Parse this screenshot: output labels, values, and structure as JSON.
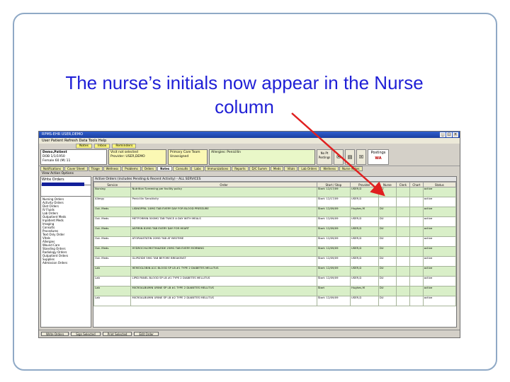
{
  "caption": {
    "line1": "The nurse’s initials now appear in the Nurse",
    "line2": "column"
  },
  "app": {
    "title": "RPMS-EHR USER,DEMO",
    "menubar": "User  Patient  Refresh Data  Tools  Help",
    "top_tabs": [
      "Notes",
      "Inbox",
      "Reminders"
    ],
    "patient": {
      "name": "Demo,Patient",
      "id": "DOB 1/1/1950",
      "extra": "Female 60 (M) 11"
    },
    "visit": {
      "line1": "Visit not selected",
      "line2": "Provider: USER,DEMO"
    },
    "primary": {
      "line1": "Primary Care Team",
      "line2": "Unassigned"
    },
    "allergy": "Allergies: Penicillin",
    "button_labels": [
      "No Pt Postings"
    ],
    "postings": {
      "line1": "Postings",
      "line2": "WA"
    },
    "tabs": [
      "Notifications",
      "Cover Sheet",
      "Triage",
      "Wellness",
      "Problems",
      "Orders",
      "Notes",
      "Consults",
      "Labs",
      "Immunizations",
      "Reports",
      "D/C Summ",
      "Meds",
      "Vitals",
      "Lab Orders",
      "Wellness",
      "Nurse Notes"
    ],
    "active_tab": "Notes",
    "subtoolbar": "View  Action  Options",
    "left_pane": {
      "header": "Write Orders",
      "list": [
        "Nursing Orders",
        "Activity Orders",
        "Diet Orders",
        "IV Fluids",
        "Lab Orders",
        "Outpatient Meds",
        "Inpatient Meds",
        "Imaging",
        "Consults",
        "Procedures",
        "Text Only Order",
        "Vitals",
        "Allergies",
        "Wound Care",
        "Standing Orders",
        "Radiology Orders",
        "Outpatient Orders",
        "Supplies",
        "Admission Orders"
      ]
    },
    "grid_title": "Active Orders (includes Pending & Recent Activity) - ALL SERVICES",
    "columns": [
      "Service",
      "Order",
      "Start / Stop",
      "Provider",
      "Nurse",
      "Clerk",
      "Chart",
      "Status"
    ],
    "rows": [
      {
        "service": "Nursing",
        "order": "Nutrition Screening per facility policy",
        "start": "Start: 12/17/09",
        "provider": "USER,D",
        "nurse": "DU",
        "status": "active"
      },
      {
        "service": "Allergy",
        "order": "Penicillin Sensitivity",
        "start": "Start: 12/17/09",
        "provider": "USER,D",
        "nurse": "",
        "status": "active"
      },
      {
        "service": "Out. Meds",
        "order": "LISINOPRIL 10MG TAB EVERY DAY FOR BLOOD PRESSURE",
        "start": "Start: 12/09/09",
        "provider": "Hughes,M",
        "nurse": "DU",
        "status": "active"
      },
      {
        "service": "Out. Meds",
        "order": "METFORMIN 500MG TAB TWICE A DAY WITH MEALS",
        "start": "Start: 12/09/09",
        "provider": "USER,D",
        "nurse": "DU",
        "status": "active"
      },
      {
        "service": "Out. Meds",
        "order": "ASPIRIN 81MG TAB EVERY DAY FOR HEART",
        "start": "Start: 12/09/09",
        "provider": "USER,D",
        "nurse": "DU",
        "status": "active"
      },
      {
        "service": "Out. Meds",
        "order": "ATORVASTATIN 20MG TAB AT BEDTIME",
        "start": "Start: 12/09/09",
        "provider": "USER,D",
        "nurse": "DU",
        "status": "active"
      },
      {
        "service": "Out. Meds",
        "order": "HYDROCHLOROTHIAZIDE 25MG TAB EVERY MORNING",
        "start": "Start: 12/09/09",
        "provider": "USER,D",
        "nurse": "DU",
        "status": "active"
      },
      {
        "service": "Out. Meds",
        "order": "GLIPIZIDE 5MG TAB BEFORE BREAKFAST",
        "start": "Start: 12/09/09",
        "provider": "USER,D",
        "nurse": "DU",
        "status": "active"
      },
      {
        "service": "Lab",
        "order": "HEMOGLOBIN A1C BLOOD SP LB #1 TYPE 2 DIABETES MELLITUS",
        "start": "Start: 12/09/09",
        "provider": "USER,D",
        "nurse": "DU",
        "status": "active"
      },
      {
        "service": "Lab",
        "order": "LIPID PANEL BLOOD SP LB #1 TYPE 2 DIABETES MELLITUS",
        "start": "Start: 12/09/09",
        "provider": "USER,D",
        "nurse": "DU",
        "status": "active"
      },
      {
        "service": "Lab",
        "order": "MICROALBUMIN URINE SP LB #1 TYPE 2 DIABETES MELLITUS",
        "start": "Start",
        "provider": "Hughes,M",
        "nurse": "DU",
        "status": "active"
      },
      {
        "service": "Lab",
        "order": "MICROALBUMIN URINE SP LB #2 TYPE 2 DIABETES MELLITUS",
        "start": "Start: 12/09/09",
        "provider": "USER,D",
        "nurse": "DU",
        "status": "active"
      }
    ],
    "status_buttons": [
      "Write Orders",
      "Sign Selected",
      "Print Selected",
      "Edit Order"
    ]
  },
  "colors": {
    "caption": "#1f1fd6",
    "arrow": "#e02020",
    "row_alt": "#d9efc8"
  }
}
